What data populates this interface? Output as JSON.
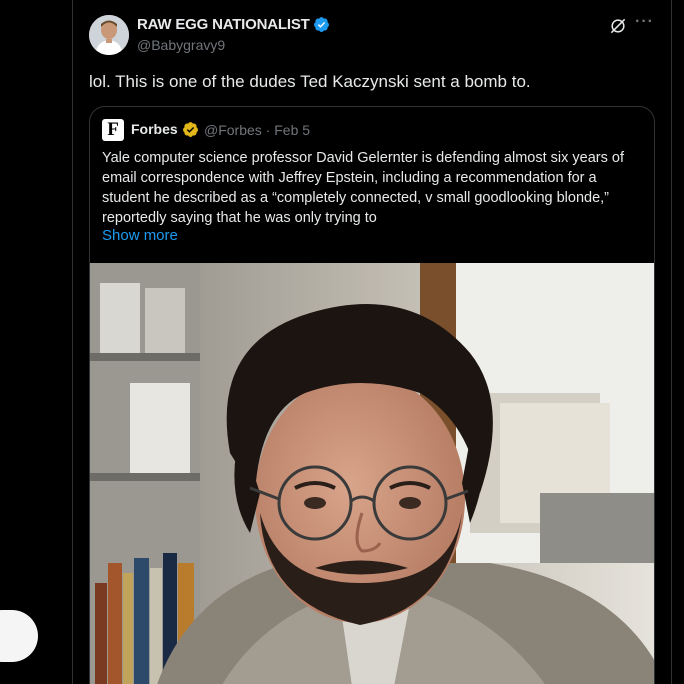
{
  "tweet": {
    "author_name": "RAW EGG NATIONALIST",
    "author_handle": "@Babygravy9",
    "text": "lol. This is one of the dudes Ted Kaczynski sent a bomb to.",
    "icons": {
      "verified": "verified-badge-icon",
      "grok": "grok-icon",
      "more": "more-icon",
      "avatar": "avatar"
    }
  },
  "quote": {
    "logo_letter": "F",
    "author_name": "Forbes",
    "meta": "@Forbes · Feb 5",
    "text": "Yale computer science professor David Gelernter is defending almost six years of email correspondence with Jeffrey Epstein, including a recommendation for a student he described as a “completely connected, v small goodlooking blonde,” reportedly saying that he was only trying to",
    "show_more": "Show more",
    "icons": {
      "badge": "gold-verified-badge-icon"
    }
  },
  "colors": {
    "background": "#000000",
    "text": "#e7e9ea",
    "muted": "#71767b",
    "link": "#1d9bf0",
    "border": "#2f3336",
    "verified_blue": "#1d9bf0",
    "verified_gold": "#e2b719"
  }
}
